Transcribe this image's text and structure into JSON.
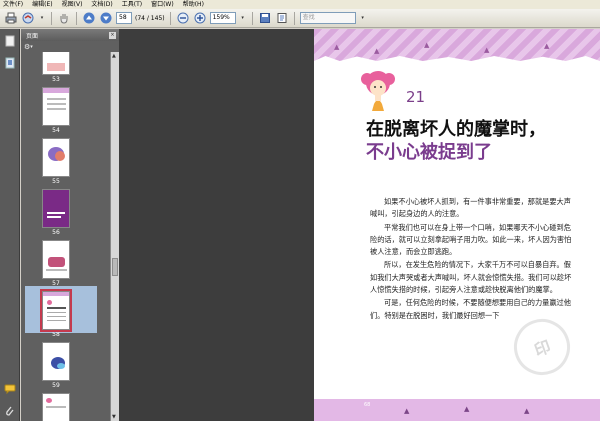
{
  "menu": {
    "items": [
      "文件(F)",
      "编辑(E)",
      "视图(V)",
      "文档(D)",
      "工具(T)",
      "窗口(W)",
      "帮助(H)"
    ]
  },
  "toolbar": {
    "page_current": "58",
    "page_total": "(74 / 145)",
    "zoom": "159%",
    "search_placeholder": "查找"
  },
  "icons": [
    "print-icon",
    "email-icon",
    "hand-icon",
    "arrow-up-icon",
    "arrow-down-icon",
    "zoom-out-icon",
    "zoom-in-icon",
    "save-icon",
    "fit-icon"
  ],
  "panel": {
    "title": "页面",
    "thumbnails": [
      {
        "label": "53"
      },
      {
        "label": "54"
      },
      {
        "label": "55"
      },
      {
        "label": "56"
      },
      {
        "label": "57"
      },
      {
        "label": "58",
        "selected": true
      },
      {
        "label": "59"
      }
    ]
  },
  "document": {
    "chapter_number": "21",
    "title_line1": "在脱离坏人的魔掌时，",
    "title_line2": "不小心被捉到了",
    "paragraphs": [
      "如果不小心被坏人抓到，有一件事非常重要，那就是要大声喊叫，引起身边的人的注意。",
      "平常我们也可以在身上带一个口哨，如果哪天不小心碰到危险的话，就可以立刻拿起哨子用力吹。如此一来，坏人因为害怕被人注意，而会立即逃跑。",
      "所以，在发生危险的情况下，大家千万不可以自暴自弃。假如我们大声哭或者大声喊叫，坏人就会惊慌失措。我们可以趁坏人惊慌失措的时候，引起旁人注意或趁快脱离他们的魔掌。",
      "可是，任何危险的时候，不要随便想要用自己的力量赢过他们。特别是在脱困时，我们最好回想一下"
    ],
    "page_number": "68"
  },
  "colors": {
    "accent_purple": "#7a3c8e",
    "band_pink": "#e3b8e6",
    "dark_bg": "#3d3d3d"
  }
}
